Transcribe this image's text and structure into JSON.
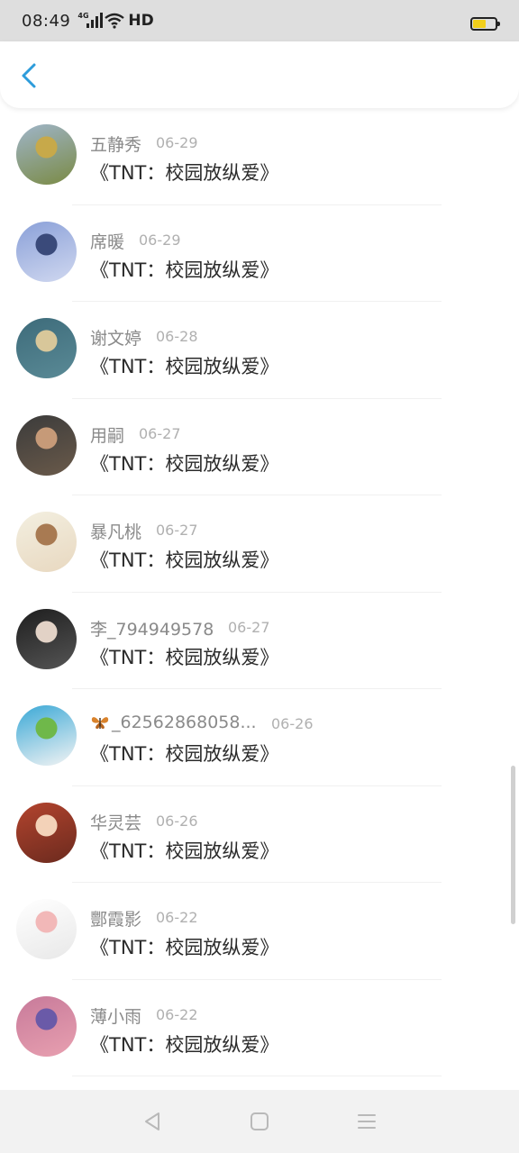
{
  "status_bar": {
    "time": "08:49",
    "network": "4G",
    "quality": "HD",
    "battery_level": 0.6,
    "battery_color": "#f2cf1b"
  },
  "header": {
    "back_icon": "chevron-left-icon",
    "accent_color": "#2d9cdb"
  },
  "items": [
    {
      "name": "五静秀",
      "date": "06-29",
      "title": "《TNT：校园放纵爱》",
      "avatar_colors": [
        "#9fb5c9",
        "#c7a94a",
        "#7a8a44"
      ]
    },
    {
      "name": "席暖",
      "date": "06-29",
      "title": "《TNT：校园放纵爱》",
      "avatar_colors": [
        "#8aa0d8",
        "#3a4a7a",
        "#d0d8f0"
      ]
    },
    {
      "name": "谢文婷",
      "date": "06-28",
      "title": "《TNT：校园放纵爱》",
      "avatar_colors": [
        "#3d6b7a",
        "#d8c79a",
        "#5a8a96"
      ]
    },
    {
      "name": "用嗣",
      "date": "06-27",
      "title": "《TNT：校园放纵爱》",
      "avatar_colors": [
        "#3b3b3b",
        "#c69a78",
        "#6a5a4a"
      ]
    },
    {
      "name": "暴凡桃",
      "date": "06-27",
      "title": "《TNT：校园放纵爱》",
      "avatar_colors": [
        "#f3efe0",
        "#a87a52",
        "#e8d8c0"
      ]
    },
    {
      "name": "李_794949578",
      "date": "06-27",
      "title": "《TNT：校园放纵爱》",
      "avatar_colors": [
        "#1e1e1e",
        "#e2d2c6",
        "#555555"
      ]
    },
    {
      "name": "_62562868058...",
      "date": "06-26",
      "title": "《TNT：校园放纵爱》",
      "avatar_colors": [
        "#3aa8d6",
        "#6fb84a",
        "#f4f4f4"
      ],
      "name_icon": "butterfly-icon"
    },
    {
      "name": "华灵芸",
      "date": "06-26",
      "title": "《TNT：校园放纵爱》",
      "avatar_colors": [
        "#b3442e",
        "#f3d2b8",
        "#6b2a1e"
      ]
    },
    {
      "name": "酆霞影",
      "date": "06-22",
      "title": "《TNT：校园放纵爱》",
      "avatar_colors": [
        "#ffffff",
        "#f2b8b8",
        "#e8e8e8"
      ]
    },
    {
      "name": "薄小雨",
      "date": "06-22",
      "title": "《TNT：校园放纵爱》",
      "avatar_colors": [
        "#c77a9a",
        "#6a5aa8",
        "#e8a0b0"
      ]
    }
  ],
  "nav_bar": {
    "back_icon": "triangle-back-icon",
    "home_icon": "square-home-icon",
    "menu_icon": "lines-menu-icon"
  }
}
